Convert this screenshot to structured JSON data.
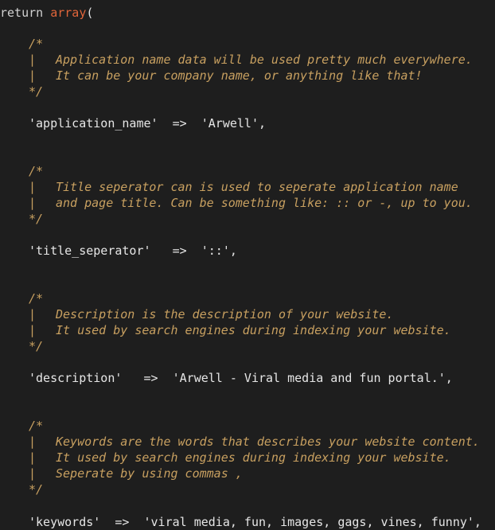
{
  "header": {
    "return_kw": "return",
    "array_fn": "array",
    "paren": "("
  },
  "blocks": [
    {
      "comment_open": "/*",
      "comment_lines": [
        "Application name data will be used pretty much everywhere.",
        "It can be your company name, or anything like that!"
      ],
      "comment_close": "*/",
      "key": "'application_name'",
      "arrow": "=>",
      "value": "'Arwell',"
    },
    {
      "comment_open": "/*",
      "comment_lines": [
        "Title seperator can is used to seperate application name",
        "and page title. Can be something like: :: or -, up to you."
      ],
      "comment_close": "*/",
      "key": "'title_seperator'",
      "arrow": "=>",
      "value": "'::',"
    },
    {
      "comment_open": "/*",
      "comment_lines": [
        "Description is the description of your website.",
        "It used by search engines during indexing your website."
      ],
      "comment_close": "*/",
      "key": "'description'",
      "arrow": "=>",
      "value": "'Arwell - Viral media and fun portal.',"
    },
    {
      "comment_open": "/*",
      "comment_lines": [
        "Keywords are the words that describes your website content.",
        "It used by search engines during indexing your website.",
        "Seperate by using commas ,"
      ],
      "comment_close": "*/",
      "key": "'keywords'",
      "arrow": "=>",
      "value": "'viral media, fun, images, gags, vines, funny',"
    }
  ],
  "comment_bar": "|",
  "colors": {
    "background": "#1e1e1e",
    "text": "#e6e6e6",
    "keyword_array": "#e0653a",
    "comment": "#c8a060"
  }
}
